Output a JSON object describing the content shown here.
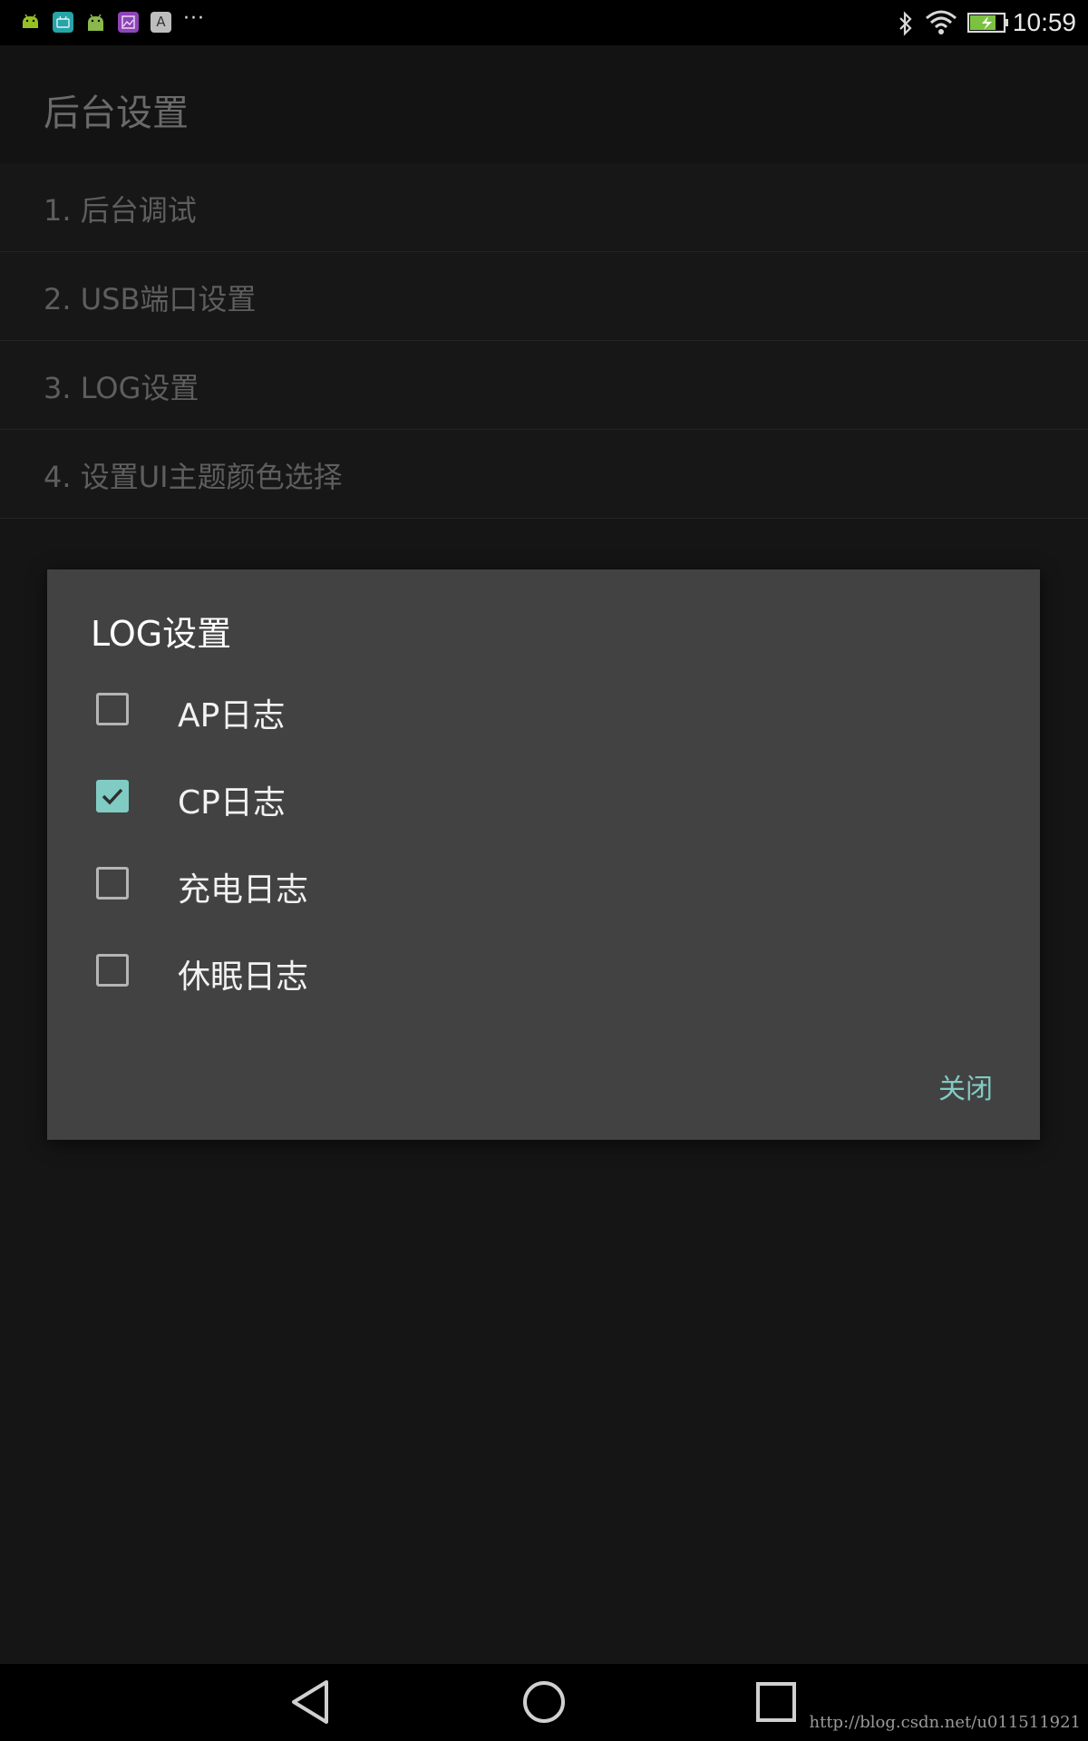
{
  "status_bar": {
    "time": "10:59",
    "overflow_glyph": "···",
    "notification_icons": [
      "android-icon",
      "android-box-icon",
      "android-icon",
      "gallery-icon",
      "font-icon"
    ],
    "font_icon_label": "A"
  },
  "app_bar": {
    "title": "后台设置"
  },
  "menu": {
    "items": [
      {
        "label": "1. 后台调试"
      },
      {
        "label": "2. USB端口设置"
      },
      {
        "label": "3. LOG设置"
      },
      {
        "label": "4. 设置UI主题颜色选择"
      }
    ]
  },
  "dialog": {
    "title": "LOG设置",
    "options": [
      {
        "label": "AP日志",
        "checked": false
      },
      {
        "label": "CP日志",
        "checked": true
      },
      {
        "label": "充电日志",
        "checked": false
      },
      {
        "label": "休眠日志",
        "checked": false
      }
    ],
    "close_label": "关闭"
  },
  "watermark": "http://blog.csdn.net/u011511921",
  "colors": {
    "accent": "#80cbc4",
    "dialog_bg": "#424242",
    "background": "#151515"
  }
}
